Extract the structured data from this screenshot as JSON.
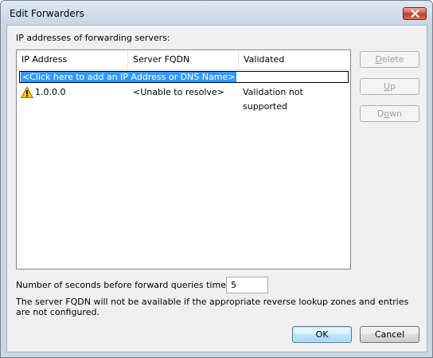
{
  "window": {
    "title": "Edit Forwarders"
  },
  "forwarders": {
    "section_label": "IP addresses of forwarding servers:",
    "columns": [
      "IP Address",
      "Server FQDN",
      "Validated"
    ],
    "add_row_text": "<Click here to add an IP Address or DNS Name>",
    "rows": [
      {
        "icon": "warning-icon",
        "ip": "1.0.0.0",
        "fqdn": "<Unable to resolve>",
        "validated": "Validation not supported"
      }
    ]
  },
  "side_buttons": {
    "delete": {
      "pre": "",
      "accel": "D",
      "post": "elete"
    },
    "up": {
      "pre": "",
      "accel": "U",
      "post": "p"
    },
    "down": {
      "pre": "D",
      "accel": "o",
      "post": "wn"
    }
  },
  "timeout": {
    "label": "Number of seconds before forward queries time out:",
    "value": "5"
  },
  "note": "The server FQDN will not be available if the appropriate reverse lookup zones and entries are not configured.",
  "footer": {
    "ok": "OK",
    "cancel": "Cancel"
  },
  "colors": {
    "selection": "#3399ff",
    "close_button": "#c0392b"
  }
}
